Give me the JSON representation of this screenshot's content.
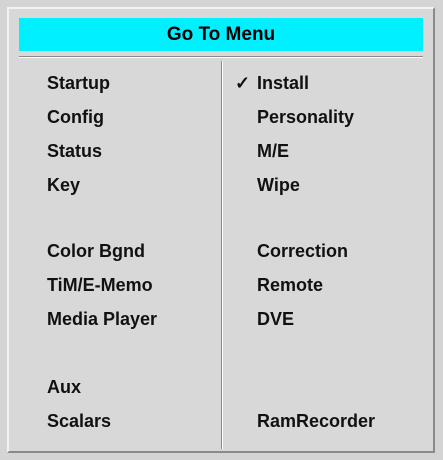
{
  "menu": {
    "title": "Go To Menu",
    "left_items": [
      "Startup",
      "Config",
      "Status",
      "Key",
      "Color Bgnd",
      "TiM/E-Memo",
      "Media Player",
      "Aux",
      "Scalars"
    ],
    "right_items": [
      "Install",
      "Personality",
      "M/E",
      "Wipe",
      "Correction",
      "Remote",
      "DVE",
      "RamRecorder"
    ],
    "checked_item": "Install",
    "check_glyph": "✓",
    "title_color": "#00f0ff"
  }
}
